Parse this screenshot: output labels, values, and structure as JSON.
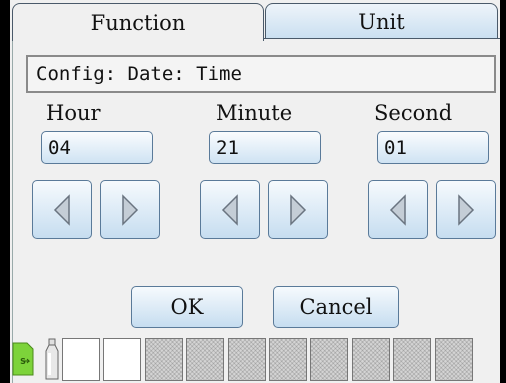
{
  "tabs": {
    "function": "Function",
    "unit": "Unit"
  },
  "config_path": "Config: Date: Time",
  "fields": {
    "hour": {
      "label": "Hour",
      "value": "04"
    },
    "minute": {
      "label": "Minute",
      "value": "21"
    },
    "second": {
      "label": "Second",
      "value": "01"
    }
  },
  "buttons": {
    "ok": "OK",
    "cancel": "Cancel"
  },
  "status_bar": {
    "sd_card_icon": "sd-card-icon",
    "bottle_icon": "bottle-icon",
    "slots": [
      "empty",
      "empty",
      "hatched",
      "hatched",
      "hatched",
      "hatched",
      "hatched",
      "hatched",
      "hatched",
      "hatched"
    ]
  },
  "colors": {
    "accent": "#c9dff0",
    "border": "#5a7a99",
    "sd_green": "#7dd33a"
  }
}
